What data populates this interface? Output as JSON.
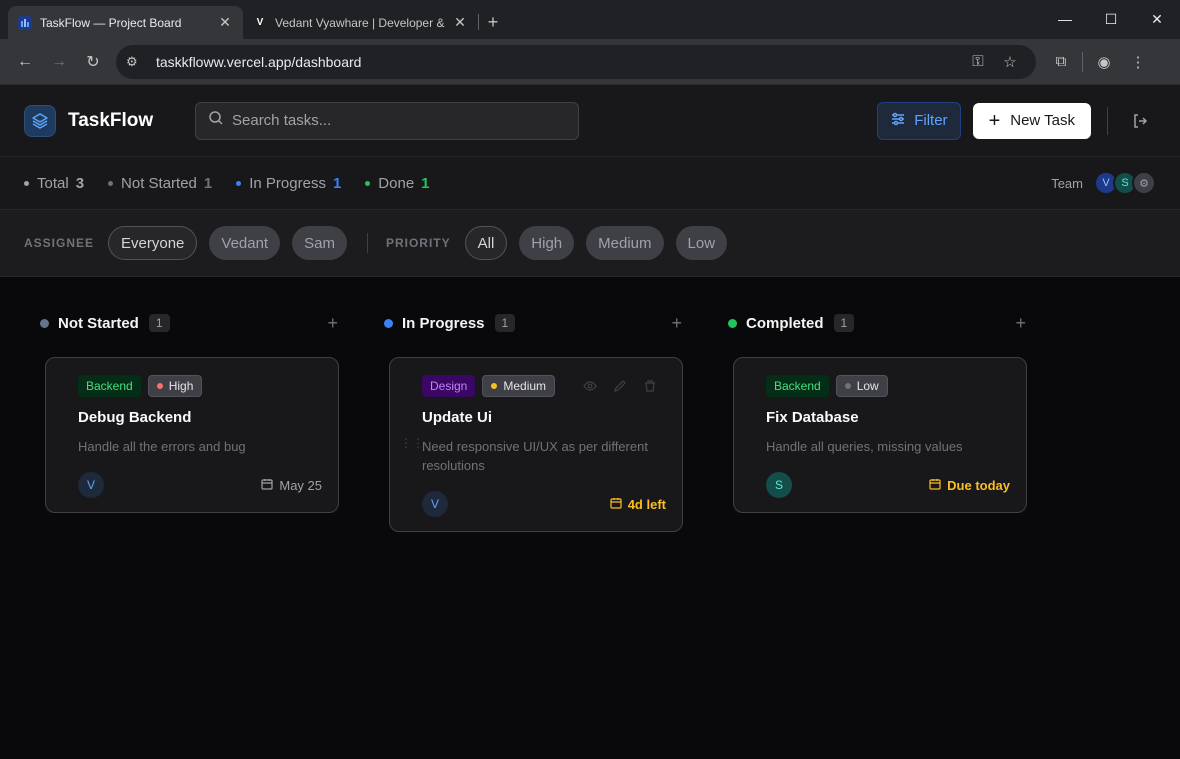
{
  "browser": {
    "tabs": [
      {
        "title": "TaskFlow — Project Board",
        "active": true
      },
      {
        "title": "Vedant Vyawhare | Developer &",
        "active": false
      }
    ],
    "url": "taskkfloww.vercel.app/dashboard"
  },
  "header": {
    "app_name": "TaskFlow",
    "search_placeholder": "Search tasks...",
    "filter_label": "Filter",
    "new_task_label": "New Task"
  },
  "stats": {
    "items": [
      {
        "label": "Total",
        "count": "3",
        "color": "#a1a1aa"
      },
      {
        "label": "Not Started",
        "count": "1",
        "color": "#71717a"
      },
      {
        "label": "In Progress",
        "count": "1",
        "color": "#3b82f6"
      },
      {
        "label": "Done",
        "count": "1",
        "color": "#22c55e"
      }
    ],
    "team_label": "Team",
    "team": [
      "V",
      "S"
    ]
  },
  "filters": {
    "assignee_label": "ASSIGNEE",
    "assignees": [
      "Everyone",
      "Vedant",
      "Sam"
    ],
    "assignee_selected": "Everyone",
    "priority_label": "PRIORITY",
    "priorities": [
      "All",
      "High",
      "Medium",
      "Low"
    ],
    "priority_selected": "All"
  },
  "columns": [
    {
      "title": "Not Started",
      "count": "1",
      "color": "#64748b",
      "cards": [
        {
          "tag": "Backend",
          "priority": "High",
          "priority_color": "#f87171",
          "title": "Debug Backend",
          "desc": "Handle all the errors and bug",
          "assignee": "V",
          "due": "May 25",
          "due_warn": false
        }
      ]
    },
    {
      "title": "In Progress",
      "count": "1",
      "color": "#3b82f6",
      "cards": [
        {
          "tag": "Design",
          "priority": "Medium",
          "priority_color": "#fbbf24",
          "title": "Update Ui",
          "desc": "Need responsive UI/UX as per different resolutions",
          "assignee": "V",
          "due": "4d left",
          "due_warn": true
        }
      ]
    },
    {
      "title": "Completed",
      "count": "1",
      "color": "#22c55e",
      "cards": [
        {
          "tag": "Backend",
          "priority": "Low",
          "priority_color": "#71717a",
          "title": "Fix Database",
          "desc": "Handle all queries, missing values",
          "assignee": "S",
          "due": "Due today",
          "due_warn": true
        }
      ]
    }
  ]
}
